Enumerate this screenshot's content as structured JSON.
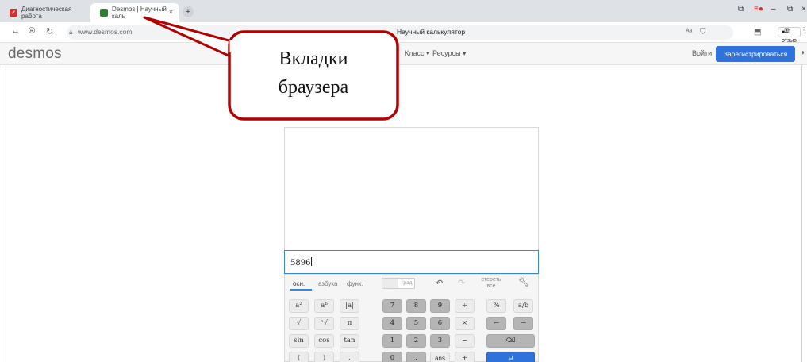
{
  "browser": {
    "tabs": [
      {
        "label": "Диагностическая работа",
        "favicon_color": "#d32f2f"
      },
      {
        "label": "Desmos | Научный каль",
        "favicon_color": "#2e7d32",
        "close": "×",
        "active": true
      }
    ],
    "new_tab": "+",
    "address": {
      "url": "www.desmos.com",
      "page_title": "Научный калькулятор",
      "reviews_badge": "41 отзыв"
    }
  },
  "desmos_header": {
    "logo": "desmos",
    "nav": [
      "Класс ▾",
      "Ресурсы ▾"
    ],
    "login": "Войти",
    "signup": "Зарегистрироваться"
  },
  "calculator": {
    "expression": "5896",
    "keypad_tabs": [
      "осн.",
      "азбука",
      "функ."
    ],
    "active_tab": "осн.",
    "angle_mode": "град",
    "clear_all": "стереть все",
    "rows": [
      [
        "a²",
        "aᵇ",
        "|a|",
        "7",
        "8",
        "9",
        "÷",
        "%",
        "a/b"
      ],
      [
        "√",
        "ⁿ√",
        "π",
        "4",
        "5",
        "6",
        "×",
        "←",
        "→"
      ],
      [
        "sin",
        "cos",
        "tan",
        "1",
        "2",
        "3",
        "−",
        "⌫"
      ],
      [
        "(",
        ")",
        ",",
        "0",
        ".",
        "ans",
        "+",
        "↵"
      ]
    ]
  },
  "callout": {
    "line1": "Вкладки",
    "line2": "браузера",
    "color": "#b30000"
  },
  "colors": {
    "accent": "#2f72dc",
    "tabbar": "#dee1e6"
  }
}
